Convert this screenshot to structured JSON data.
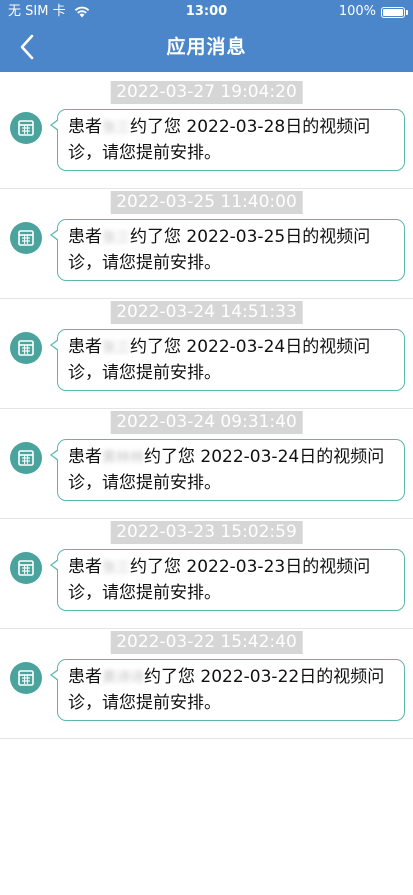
{
  "status_bar": {
    "carrier": "无 SIM 卡",
    "time": "13:00",
    "battery": "100%"
  },
  "nav": {
    "title": "应用消息",
    "back_icon": "chevron-left-icon"
  },
  "colors": {
    "header": "#4a86c9",
    "icon_circle": "#4aa39c",
    "bubble_border": "#5cb8ae",
    "timestamp_bg": "#d6d6d6"
  },
  "messages": [
    {
      "timestamp": "2022-03-27 19:04:20",
      "prefix": "患者",
      "name": "张三",
      "suffix": "约了您 2022-03-28日的视频问诊，请您提前安排。"
    },
    {
      "timestamp": "2022-03-25 11:40:00",
      "prefix": "患者",
      "name": "张三",
      "suffix": "约了您 2022-03-25日的视频问诊，请您提前安排。"
    },
    {
      "timestamp": "2022-03-24 14:51:33",
      "prefix": "患者",
      "name": "张三",
      "suffix": "约了您 2022-03-24日的视频问诊，请您提前安排。"
    },
    {
      "timestamp": "2022-03-24 09:31:40",
      "prefix": "患者",
      "name": "黄林林",
      "suffix": "约了您 2022-03-24日的视频问诊，请您提前安排。"
    },
    {
      "timestamp": "2022-03-23 15:02:59",
      "prefix": "患者",
      "name": "张三",
      "suffix": "约了您 2022-03-23日的视频问诊，请您提前安排。"
    },
    {
      "timestamp": "2022-03-22 15:42:40",
      "prefix": "患者",
      "name": "黄诗诗",
      "suffix": "约了您 2022-03-22日的视频问诊，请您提前安排。"
    }
  ]
}
